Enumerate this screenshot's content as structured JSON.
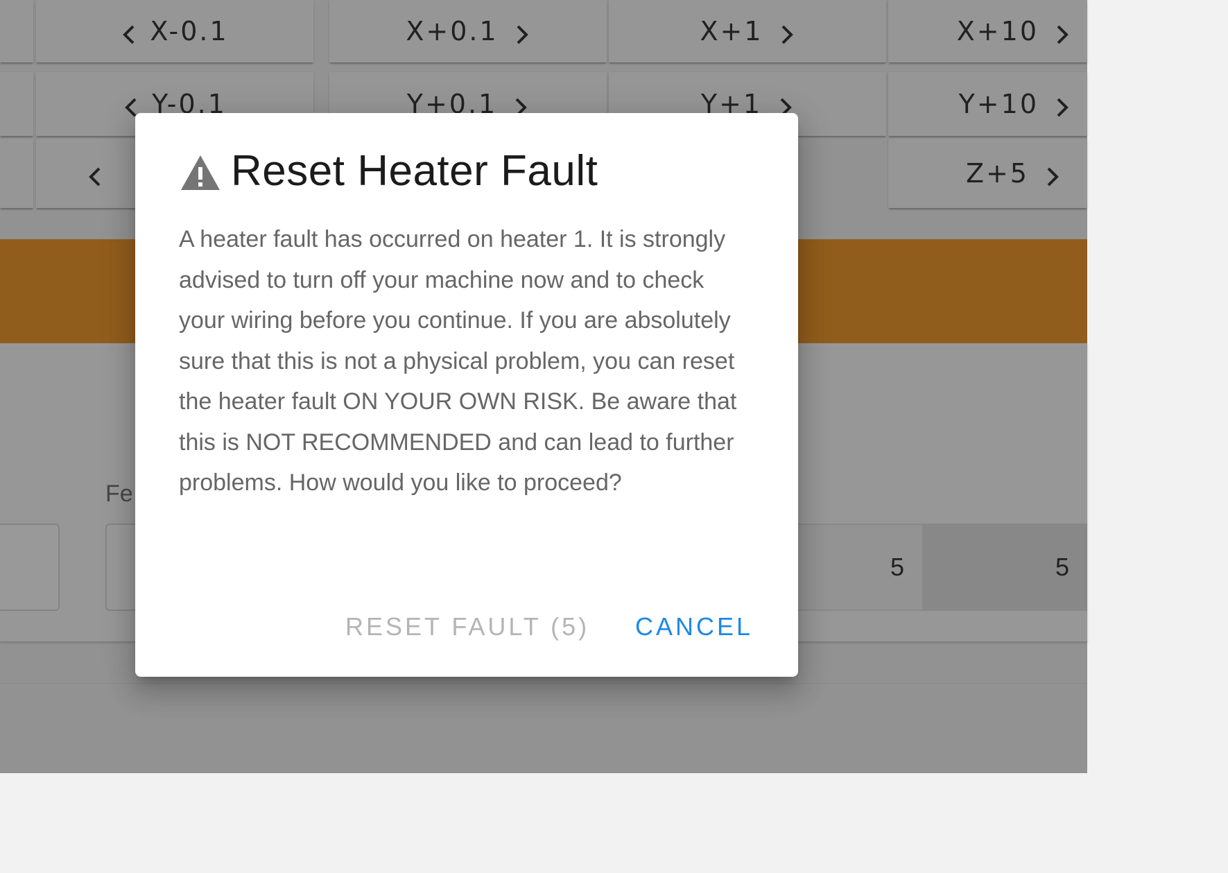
{
  "jog": {
    "row_x": [
      "X-0.1",
      "X+0.1",
      "X+1",
      "X+10"
    ],
    "row_y": [
      "Y-0.1",
      "Y+0.1",
      "Y+1",
      "Y+10"
    ],
    "row_z_last": "Z+5"
  },
  "panel": {
    "feed_label_partial": "Fe",
    "segment_partial": "5",
    "segment_value": "5"
  },
  "dialog": {
    "title": "Reset Heater Fault",
    "icon": "warning-icon",
    "body": "A heater fault has occurred on heater 1. It is strongly advised to turn off your machine now and to check your wiring before you continue. If you are absolutely sure that this is not a physical problem, you can reset the heater fault ON YOUR OWN RISK. Be aware that this is NOT RECOMMENDED and can lead to further problems. How would you like to proceed?",
    "reset_label": "RESET FAULT (5)",
    "cancel_label": "CANCEL"
  },
  "colors": {
    "accent_orange": "#f0901b",
    "cancel_blue": "#1e88e5"
  }
}
